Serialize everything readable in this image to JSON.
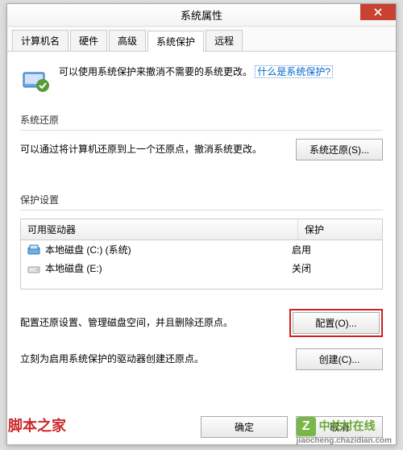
{
  "window": {
    "title": "系统属性"
  },
  "tabs": [
    {
      "label": "计算机名"
    },
    {
      "label": "硬件"
    },
    {
      "label": "高级"
    },
    {
      "label": "系统保护",
      "active": true
    },
    {
      "label": "远程"
    }
  ],
  "intro": {
    "text": "可以使用系统保护来撤消不需要的系统更改。",
    "link": "什么是系统保护?"
  },
  "restore": {
    "title": "系统还原",
    "text": "可以通过将计算机还原到上一个还原点，撤消系统更改。",
    "button": "系统还原(S)..."
  },
  "protection": {
    "title": "保护设置",
    "columns": {
      "drive": "可用驱动器",
      "status": "保护"
    },
    "rows": [
      {
        "icon": "hdd-primary",
        "name": "本地磁盘 (C:) (系统)",
        "status": "启用"
      },
      {
        "icon": "hdd",
        "name": "本地磁盘 (E:)",
        "status": "关闭"
      }
    ],
    "config": {
      "text": "配置还原设置、管理磁盘空间，并且删除还原点。",
      "button": "配置(O)..."
    },
    "create": {
      "text": "立刻为启用系统保护的驱动器创建还原点。",
      "button": "创建(C)..."
    }
  },
  "footer": {
    "ok": "确定",
    "cancel": "取消"
  },
  "watermarks": {
    "w1": "脚本之家",
    "w2_main": "中关村在线",
    "w2_sub": "jiaocheng.chazidian.com"
  }
}
